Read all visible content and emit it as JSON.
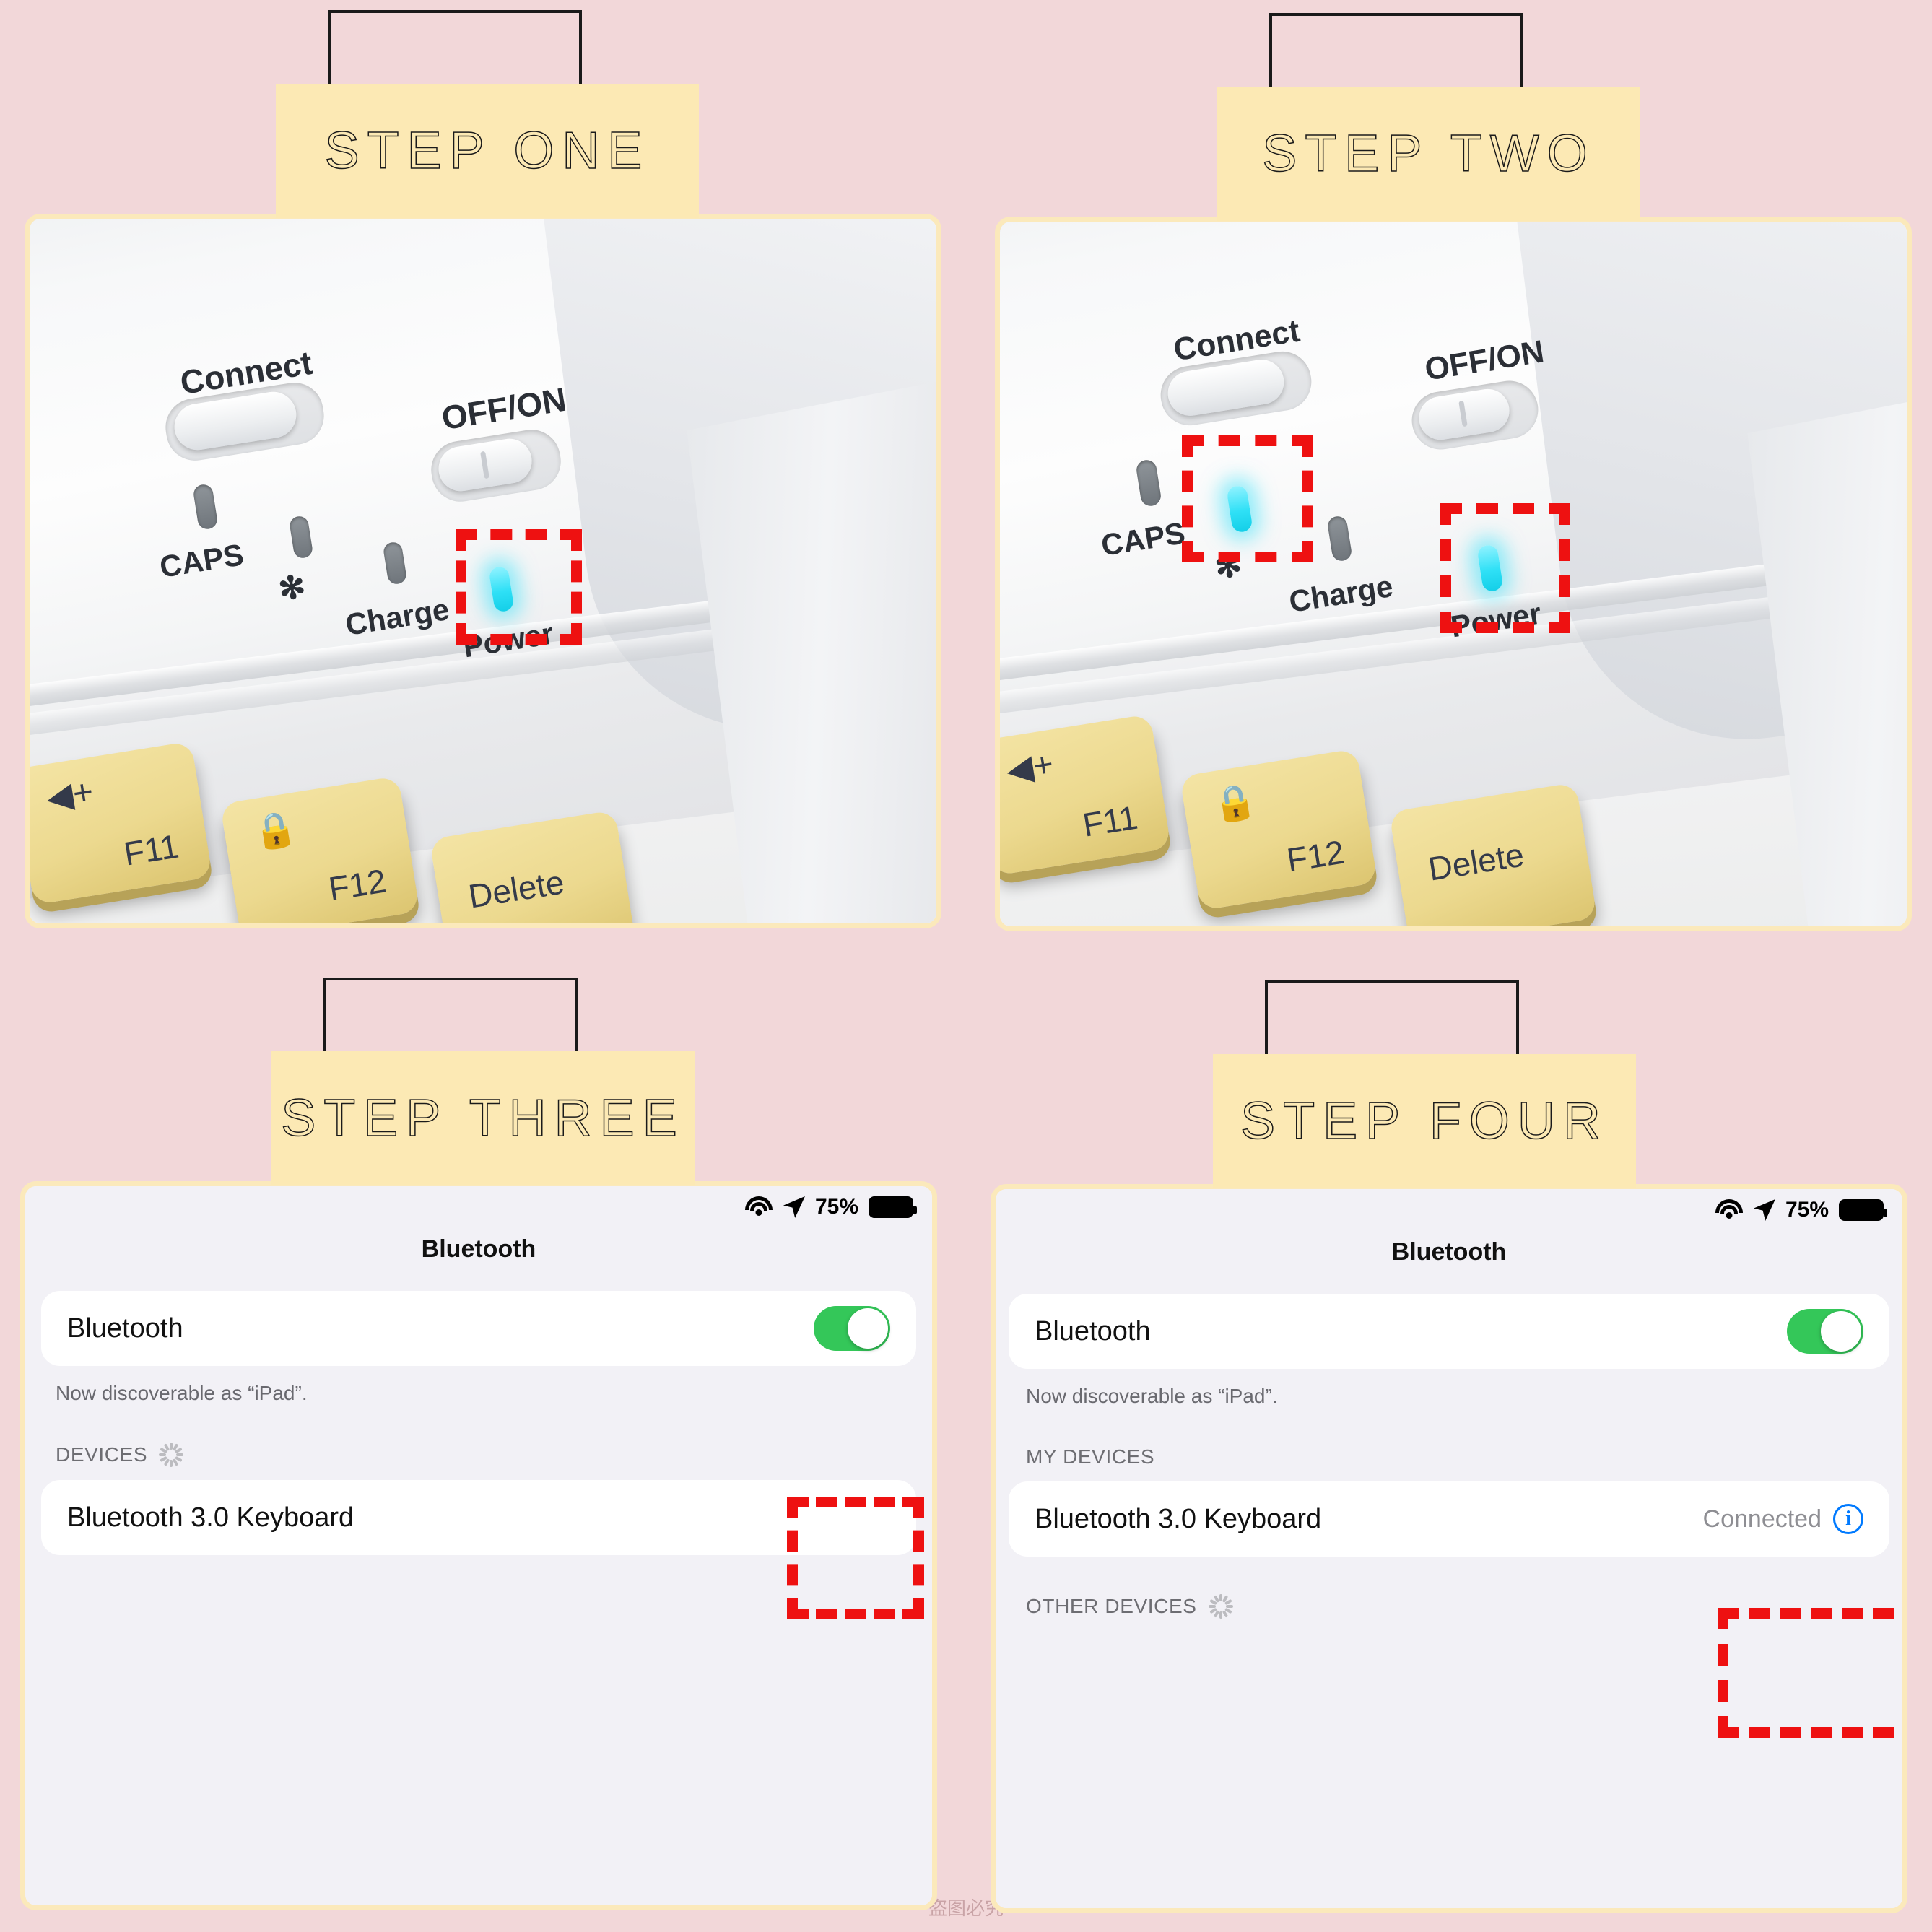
{
  "theme": {
    "background": "#f2d7d9",
    "banner_bg": "#fce9b4",
    "panel_border": "#fbe9bb",
    "marker_color": "#ee1111",
    "led_on_color": "#2fe0f6",
    "toggle_on_color": "#34c759",
    "info_blue": "#007aff",
    "screen_bg": "#f2f1f6"
  },
  "watermark": "盗图必究",
  "steps": [
    {
      "id": "step-one",
      "title": "STEP ONE",
      "kind": "photo",
      "photo": {
        "labels": [
          "Connect",
          "OFF/ON",
          "CAPS",
          "Charge",
          "Power"
        ],
        "bluetooth_glyph": "✻",
        "leds": [
          {
            "name": "caps-led",
            "lit": false
          },
          {
            "name": "bluetooth-led",
            "lit": false
          },
          {
            "name": "charge-led",
            "lit": false
          },
          {
            "name": "power-led",
            "lit": true
          }
        ],
        "keys": [
          {
            "label": "F11",
            "icon": "🔊+"
          },
          {
            "label": "F12",
            "icon": "🔒"
          },
          {
            "label": "Delete",
            "icon": ""
          }
        ],
        "markers": [
          "power-led"
        ]
      }
    },
    {
      "id": "step-two",
      "title": "STEP TWO",
      "kind": "photo",
      "photo": {
        "labels": [
          "Connect",
          "OFF/ON",
          "CAPS",
          "Charge",
          "Power"
        ],
        "bluetooth_glyph": "✻",
        "leds": [
          {
            "name": "caps-led",
            "lit": false
          },
          {
            "name": "bluetooth-led",
            "lit": true
          },
          {
            "name": "charge-led",
            "lit": false
          },
          {
            "name": "power-led",
            "lit": true
          }
        ],
        "keys": [
          {
            "label": "F11",
            "icon": "🔊+"
          },
          {
            "label": "F12",
            "icon": "🔒"
          },
          {
            "label": "Delete",
            "icon": ""
          }
        ],
        "markers": [
          "bluetooth-led",
          "power-led"
        ]
      }
    },
    {
      "id": "step-three",
      "title": "STEP THREE",
      "kind": "screen",
      "screen": {
        "status": {
          "battery_percent": "75%"
        },
        "nav_title": "Bluetooth",
        "toggle_row_label": "Bluetooth",
        "toggle_on": true,
        "footnote": "Now discoverable as “iPad”.",
        "section_label": "DEVICES",
        "section_spinner": true,
        "devices": [
          {
            "name": "Bluetooth 3.0 Keyboard",
            "status": ""
          }
        ],
        "markers": [
          "bluetooth-toggle"
        ]
      }
    },
    {
      "id": "step-four",
      "title": "STEP FOUR",
      "kind": "screen",
      "screen": {
        "status": {
          "battery_percent": "75%"
        },
        "nav_title": "Bluetooth",
        "toggle_row_label": "Bluetooth",
        "toggle_on": true,
        "footnote": "Now discoverable as “iPad”.",
        "section_label": "MY DEVICES",
        "section_spinner": false,
        "devices": [
          {
            "name": "Bluetooth 3.0 Keyboard",
            "status": "Connected"
          }
        ],
        "other_section_label": "OTHER DEVICES",
        "other_section_spinner": true,
        "markers": [
          "device-status"
        ]
      }
    }
  ]
}
